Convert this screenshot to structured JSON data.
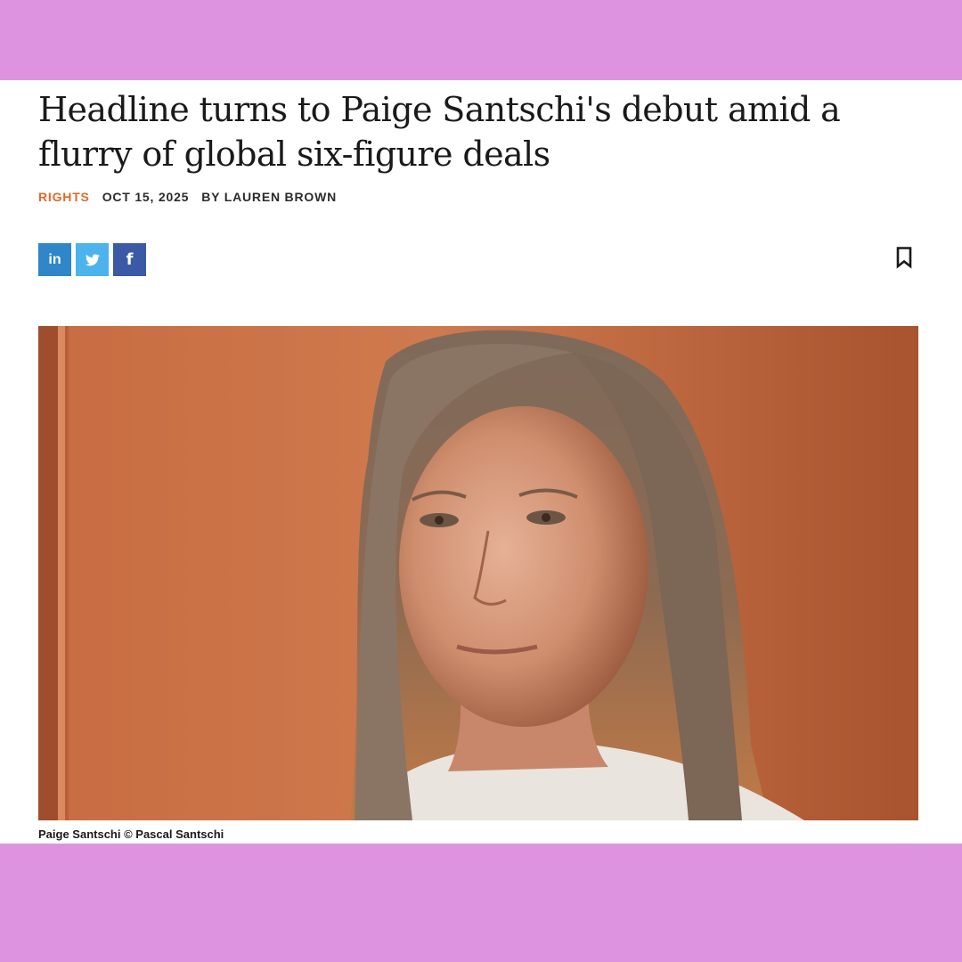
{
  "article": {
    "headline": "Headline turns to Paige Santschi's debut amid a flurry of global six-figure deals",
    "category": "RIGHTS",
    "date": "OCT 15, 2025",
    "byline": "BY LAUREN BROWN",
    "caption": "Paige Santschi © Pascal Santschi"
  },
  "share": {
    "linkedin_label": "in",
    "twitter_icon": "twitter-bird-icon",
    "facebook_label": "f"
  },
  "icons": {
    "bookmark": "bookmark-icon"
  },
  "colors": {
    "band": "#de93e0",
    "category": "#e0692a",
    "linkedin": "#2f86c8",
    "twitter": "#4db3ec",
    "facebook": "#3b5aa6",
    "photo_background": "#c0673d"
  }
}
